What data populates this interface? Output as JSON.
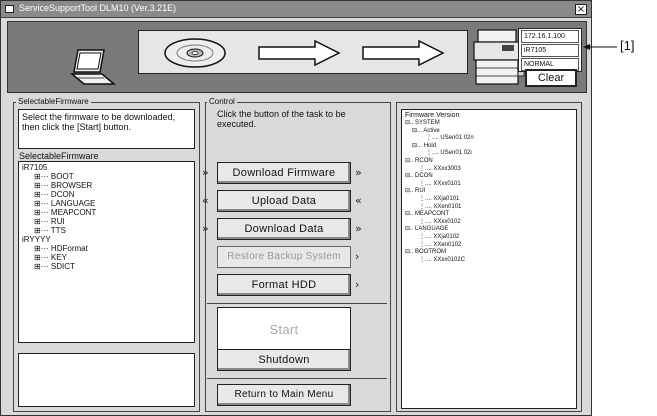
{
  "titlebar": {
    "title": "ServiceSupportTool DLM10 (Ver.3.21E)",
    "close": "×"
  },
  "device_info": {
    "ip": "172.16.1.100",
    "model": "iR7105",
    "mode": "NORMAL"
  },
  "clear_label": "Clear",
  "callout_label": "[1]",
  "left": {
    "panel_label": "SelectableFirmware",
    "instruction": "Select the firmware to be downloaded, then click the [Start] button.",
    "list_title": "SelectableFirmware",
    "groups": [
      {
        "name": "iR7105",
        "items": [
          "BOOT",
          "BROWSER",
          "DCON",
          "LANGUAGE",
          "MEAPCONT",
          "RUI",
          "TTS"
        ]
      },
      {
        "name": "iRYYYY",
        "items": [
          "HDFormat",
          "KEY",
          "SDICT"
        ]
      }
    ]
  },
  "control": {
    "panel_label": "Control",
    "instruction": "Click the button of the task to be executed.",
    "buttons": [
      {
        "label": "Download Firmware"
      },
      {
        "label": "Upload Data"
      },
      {
        "label": "Download Data"
      },
      {
        "label": "Restore Backup System"
      },
      {
        "label": "Format HDD"
      }
    ],
    "start": "Start",
    "shutdown": "Shutdown",
    "return": "Return to Main Menu"
  },
  "firmware_version": {
    "header": "Firmware Version",
    "tree": [
      [
        "SYSTEM",
        0
      ],
      [
        "Active",
        1
      ],
      [
        "USen01 02n",
        3
      ],
      [
        "Hold",
        1
      ],
      [
        "USen01 02i",
        3
      ],
      [
        "RCON",
        0
      ],
      [
        "XXxx3003",
        2
      ],
      [
        "DCON",
        0
      ],
      [
        "XXxx0101",
        2
      ],
      [
        "RUI",
        0
      ],
      [
        "XXja0101",
        2
      ],
      [
        "XXen0101",
        2
      ],
      [
        "MEAPCONT",
        0
      ],
      [
        "XXxx0102",
        2
      ],
      [
        "LANGUAGE",
        0
      ],
      [
        "XXja0102",
        2
      ],
      [
        "XXen0102",
        2
      ],
      [
        "BOOTROM",
        0
      ],
      [
        "XXxx0102C",
        2
      ]
    ]
  },
  "icons": [
    "laptop-icon",
    "disc-icon",
    "arrow-right-icon",
    "copier-icon"
  ]
}
